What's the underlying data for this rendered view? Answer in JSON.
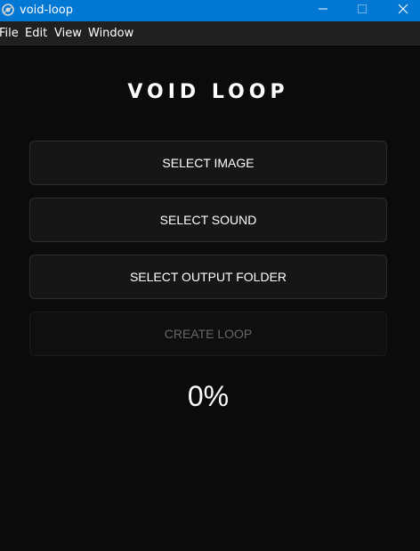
{
  "window": {
    "title": "void-loop",
    "app_icon": "app-logo-icon",
    "controls": [
      "minimize-icon",
      "maximize-icon",
      "close-icon"
    ],
    "titlebar_color": "#0078d4"
  },
  "menubar": {
    "items": [
      "File",
      "Edit",
      "View",
      "Window"
    ]
  },
  "main": {
    "title": "VOID LOOP",
    "buttons": {
      "select_image": "SELECT IMAGE",
      "select_sound": "SELECT SOUND",
      "select_output_folder": "SELECT OUTPUT FOLDER",
      "create_loop": "CREATE LOOP"
    },
    "create_loop_disabled": true,
    "progress": "0%"
  },
  "colors": {
    "background": "#0b0b0b",
    "button_bg": "#161616",
    "disabled_text": "#666666"
  }
}
